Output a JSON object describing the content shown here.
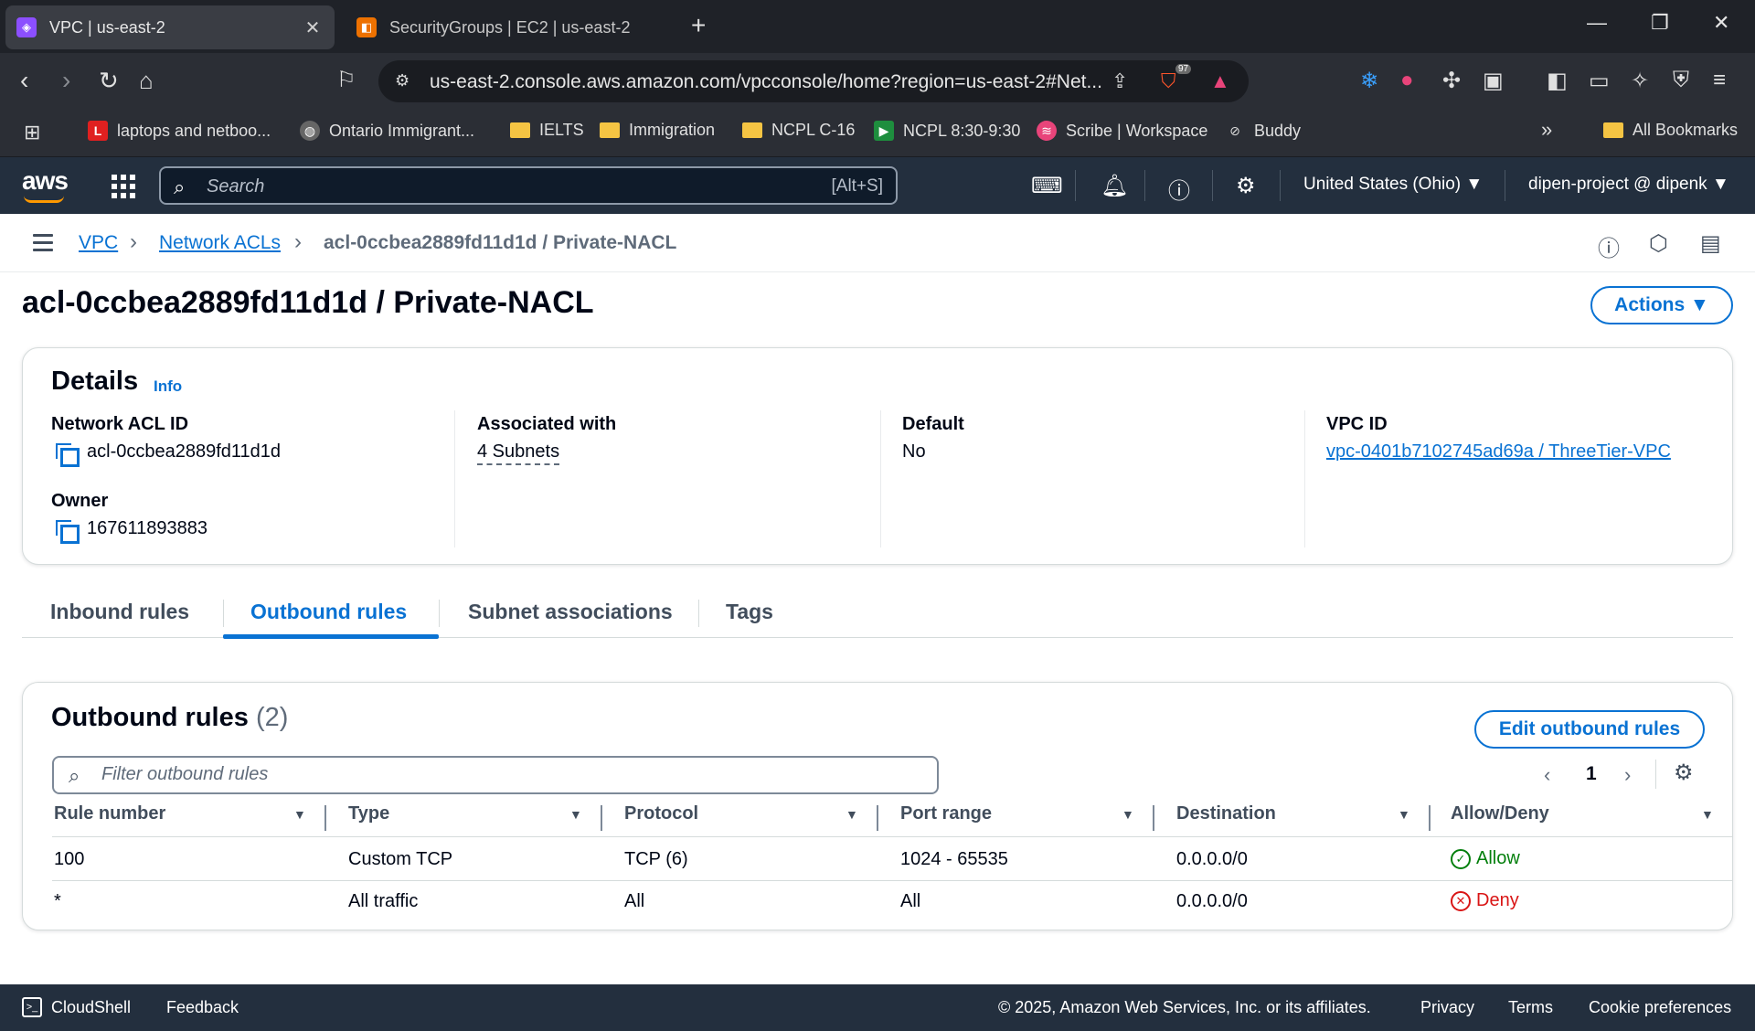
{
  "browser": {
    "tabs": [
      {
        "title": "VPC | us-east-2",
        "active": true,
        "icon": "vpc-icon",
        "close": "✕"
      },
      {
        "title": "SecurityGroups | EC2 | us-east-2",
        "active": false,
        "icon": "ec2-icon"
      }
    ],
    "url": "us-east-2.console.aws.amazon.com/vpcconsole/home?region=us-east-2#Net...",
    "brave_badge": "97",
    "bookmarks": [
      {
        "label": "laptops and netboo...",
        "icon": "L"
      },
      {
        "label": "Ontario Immigrant...",
        "icon": "globe-icon"
      },
      {
        "label": "IELTS",
        "icon": "folder-icon"
      },
      {
        "label": "Immigration",
        "icon": "folder-icon"
      },
      {
        "label": "NCPL C-16",
        "icon": "folder-icon"
      },
      {
        "label": "NCPL 8:30-9:30",
        "icon": "meet-icon"
      },
      {
        "label": "Scribe | Workspace",
        "icon": "scribe-icon"
      },
      {
        "label": "Buddy",
        "icon": "buddy-icon"
      }
    ],
    "all_bookmarks": "All Bookmarks",
    "overflow": "»"
  },
  "aws_nav": {
    "logo": "aws",
    "search_placeholder": "Search",
    "search_shortcut": "[Alt+S]",
    "region": "United States (Ohio) ▼",
    "account": "dipen-project @ dipenk ▼"
  },
  "breadcrumb": {
    "items": [
      "VPC",
      "Network ACLs"
    ],
    "current": "acl-0ccbea2889fd11d1d / Private-NACL",
    "separator": "›"
  },
  "page": {
    "title": "acl-0ccbea2889fd11d1d / Private-NACL",
    "actions_label": "Actions ▼"
  },
  "details": {
    "heading": "Details",
    "info": "Info",
    "network_acl_id_label": "Network ACL ID",
    "network_acl_id": "acl-0ccbea2889fd11d1d",
    "owner_label": "Owner",
    "owner": "167611893883",
    "associated_label": "Associated with",
    "associated": "4 Subnets",
    "default_label": "Default",
    "default": "No",
    "vpc_id_label": "VPC ID",
    "vpc_id": "vpc-0401b7102745ad69a / ThreeTier-VPC"
  },
  "tabs": [
    "Inbound rules",
    "Outbound rules",
    "Subnet associations",
    "Tags"
  ],
  "active_tab": "Outbound rules",
  "outbound": {
    "heading": "Outbound rules",
    "count": "(2)",
    "edit_label": "Edit outbound rules",
    "filter_placeholder": "Filter outbound rules",
    "page": "1",
    "columns": [
      "Rule number",
      "Type",
      "Protocol",
      "Port range",
      "Destination",
      "Allow/Deny"
    ],
    "rows": [
      {
        "rule": "100",
        "type": "Custom TCP",
        "protocol": "TCP (6)",
        "port": "1024 - 65535",
        "destination": "0.0.0.0/0",
        "action": "Allow"
      },
      {
        "rule": "*",
        "type": "All traffic",
        "protocol": "All",
        "port": "All",
        "destination": "0.0.0.0/0",
        "action": "Deny"
      }
    ]
  },
  "footer": {
    "cloudshell": "CloudShell",
    "feedback": "Feedback",
    "copyright": "© 2025, Amazon Web Services, Inc. or its affiliates.",
    "privacy": "Privacy",
    "terms": "Terms",
    "cookies": "Cookie preferences"
  },
  "colors": {
    "link": "#0972d3",
    "allow": "#037f0c",
    "deny": "#d91515",
    "aws_nav": "#232f3e"
  }
}
